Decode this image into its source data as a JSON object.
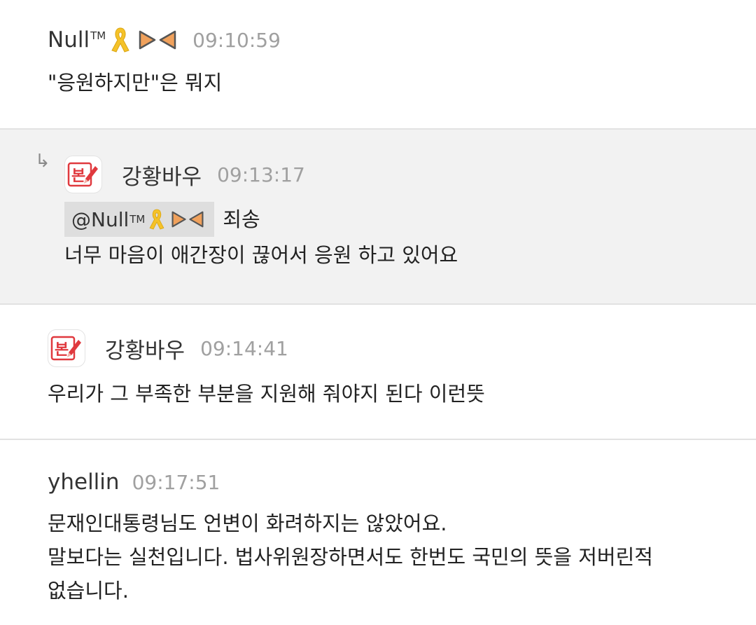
{
  "messages": [
    {
      "author": "Null",
      "author_sup": "TM",
      "time": "09:10:59",
      "lines": [
        "\"응원하지만\"은 뭐지"
      ]
    },
    {
      "reply_arrow": "↳",
      "author": "강황바우",
      "avatar_label": "본",
      "time": "09:13:17",
      "mention": {
        "name": "@Null",
        "sup": "TM"
      },
      "lines": [
        "죄송",
        "너무 마음이 애간장이 끊어서 응원 하고 있어요"
      ]
    },
    {
      "author": "강황바우",
      "avatar_label": "본",
      "time": "09:14:41",
      "lines": [
        "우리가 그 부족한 부분을 지원해 줘야지 된다 이런뜻"
      ]
    },
    {
      "author": "yhellin",
      "time": "09:17:51",
      "lines": [
        "문재인대통령님도 언변이 화려하지는 않았어요.",
        "말보다는 실천입니다. 법사위원장하면서도 한번도 국민의 뜻을 저버린적",
        "없습니다."
      ]
    }
  ],
  "colors": {
    "divider": "#e2e2e2",
    "reply_bg": "#f2f2f2",
    "time": "#a0a0a0",
    "ribbon": "#f5c228",
    "bow": "#f0a15c",
    "avatar_red": "#e0393e"
  },
  "icons": [
    "yellow-ribbon-icon",
    "bow-tie-icon",
    "pen-avatar-icon",
    "reply-arrow-icon"
  ]
}
